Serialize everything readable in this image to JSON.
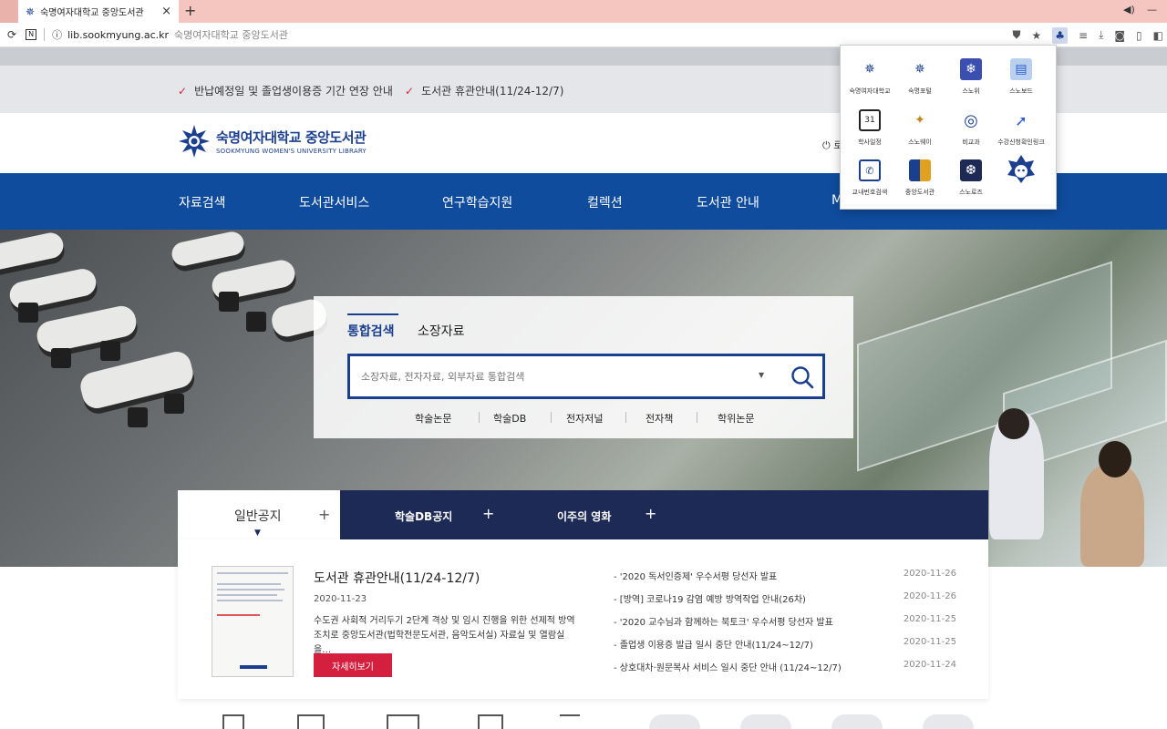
{
  "browser": {
    "tab_title": "숙명여자대학교 중앙도서관",
    "tab_close": "×",
    "new_tab": "+",
    "url_host": "lib.sookmyung.ac.kr",
    "page_title": "숙명여자대학교 중앙도서관"
  },
  "notice_bar": [
    "반납예정일 및 졸업생이용증 기간 연장 안내",
    "도서관 휴관안내(11/24-12/7)"
  ],
  "header": {
    "logo_kr": "숙명여자대학교 중앙도서관",
    "logo_en": "SOOKMYUNG WOMEN'S UNIVERSITY LIBRARY",
    "login_label": "로"
  },
  "nav": [
    "자료검색",
    "도서관서비스",
    "연구학습지원",
    "컬렉션",
    "도서관 안내",
    "M"
  ],
  "search": {
    "tabs": [
      "통합검색",
      "소장자료"
    ],
    "placeholder": "소장자료, 전자자료, 외부자료 통합검색",
    "quick_links": [
      "학술논문",
      "학술DB",
      "전자저널",
      "전자책",
      "학위논문"
    ]
  },
  "board": {
    "tabs": [
      "일반공지",
      "학술DB공지",
      "이주의 영화"
    ],
    "featured": {
      "title": "도서관 휴관안내(11/24-12/7)",
      "date": "2020-11-23",
      "body": "수도권 사회적 거리두기 2단계 격상 및 임시 진행을 위한 선제적 방역조치로 중앙도서관(법학전문도서관, 음악도서실) 자료실 및 열람실을…",
      "more_label": "자세히보기"
    },
    "list": [
      {
        "title": "- '2020 독서인증제' 우수서평 당선자 발표",
        "date": "2020-11-26"
      },
      {
        "title": "- [방역] 코로나19 감염 예방 방역작업 안내(26차)",
        "date": "2020-11-26"
      },
      {
        "title": "- '2020 교수님과 함께하는 북토크' 우수서평 당선자 발표",
        "date": "2020-11-25"
      },
      {
        "title": "- 졸업생 이용증 발급 일시 중단 안내(11/24~12/7)",
        "date": "2020-11-25"
      },
      {
        "title": "- 상호대차·원문복사 서비스 일시 중단 안내 (11/24~12/7)",
        "date": "2020-11-24"
      }
    ]
  },
  "popup": {
    "items": [
      {
        "label": "숙명여자대학교",
        "icon": "university-emblem-icon",
        "color": "#1b3f8f"
      },
      {
        "label": "숙명포털",
        "icon": "portal-emblem-icon",
        "color": "#1b3f8f"
      },
      {
        "label": "스노위",
        "icon": "snowflake-icon",
        "color": "#3a4fb0"
      },
      {
        "label": "스노보드",
        "icon": "board-icon",
        "color": "#4b7fd0"
      },
      {
        "label": "학사일정",
        "icon": "calendar-icon",
        "color": "#222"
      },
      {
        "label": "스노웨이",
        "icon": "map-pin-icon",
        "color": "#c08a20"
      },
      {
        "label": "비교과",
        "icon": "target-icon",
        "color": "#1b3f8f"
      },
      {
        "label": "수강신청확인링크",
        "icon": "cursor-icon",
        "color": "#2a5bd0"
      },
      {
        "label": "교내번호검색",
        "icon": "phone-icon",
        "color": "#1b3f8f"
      },
      {
        "label": "중앙도서관",
        "icon": "books-icon",
        "color": "#e0a020"
      },
      {
        "label": "스노로즈",
        "icon": "snow-rose-icon",
        "color": "#1c2a55"
      },
      {
        "label": "",
        "icon": "mascot-icon",
        "color": "#1b3f8f"
      }
    ]
  }
}
